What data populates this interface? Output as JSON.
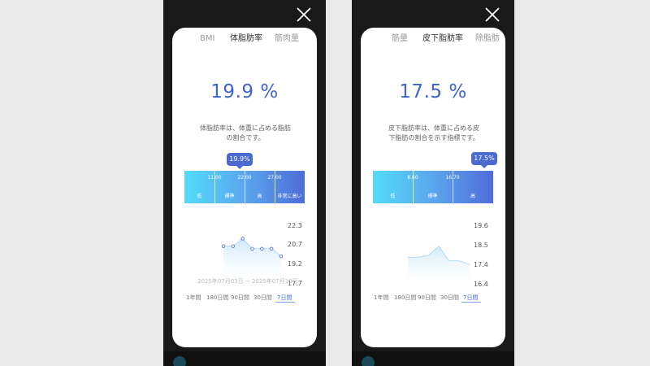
{
  "colors": {
    "accent": "#3f63c9",
    "gauge_start": "#52dcfa",
    "gauge_end": "#4f6cd7",
    "chart_fill": "#cfeaf8"
  },
  "screens": [
    {
      "tabs": [
        {
          "label": "BMI",
          "active": false
        },
        {
          "label": "体脂肪率",
          "active": true
        },
        {
          "label": "筋肉量",
          "active": false
        }
      ],
      "value_text": "19.9 %",
      "description": "体脂肪率は、体重に占める脂肪の割合です。",
      "gauge": {
        "ticks": [
          "11.00",
          "22.00",
          "27.00"
        ],
        "segments": [
          "低",
          "標準",
          "高",
          "非常に高い"
        ],
        "bubble": "19.9%"
      },
      "chart_data": {
        "type": "line",
        "y_ticks": [
          "22.3",
          "20.7",
          "19.2",
          "17.7"
        ],
        "ylim": [
          17.7,
          22.3
        ],
        "values": [
          20.7,
          20.7,
          21.3,
          20.5,
          20.5,
          20.5,
          19.9
        ],
        "markers": true
      },
      "date_range": "2025年07月03日 ~ 2025年07月10日",
      "periods": [
        {
          "label": "1年間",
          "active": false
        },
        {
          "label": "180日間",
          "active": false
        },
        {
          "label": "90日間",
          "active": false
        },
        {
          "label": "30日間",
          "active": false
        },
        {
          "label": "7日間",
          "active": true
        }
      ]
    },
    {
      "tabs": [
        {
          "label": "筋量",
          "active": false
        },
        {
          "label": "皮下脂肪率",
          "active": true
        },
        {
          "label": "除脂肪",
          "active": false
        }
      ],
      "value_text": "17.5 %",
      "description": "皮下脂肪率は、体重に占める皮下脂肪の割合を示す指標です。",
      "gauge": {
        "ticks": [
          "8.60",
          "16.70"
        ],
        "segments": [
          "低",
          "標準",
          "高"
        ],
        "bubble": "17.5%"
      },
      "chart_data": {
        "type": "area",
        "y_ticks": [
          "19.6",
          "18.5",
          "17.4",
          "16.4"
        ],
        "ylim": [
          16.4,
          19.6
        ],
        "values": [
          17.9,
          17.9,
          18.0,
          18.5,
          17.7,
          17.7,
          17.5
        ],
        "markers": false
      },
      "date_range": "",
      "periods": [
        {
          "label": "1年間",
          "active": false
        },
        {
          "label": "180日間",
          "active": false
        },
        {
          "label": "90日間",
          "active": false
        },
        {
          "label": "30日間",
          "active": false
        },
        {
          "label": "7日間",
          "active": true
        }
      ]
    }
  ]
}
